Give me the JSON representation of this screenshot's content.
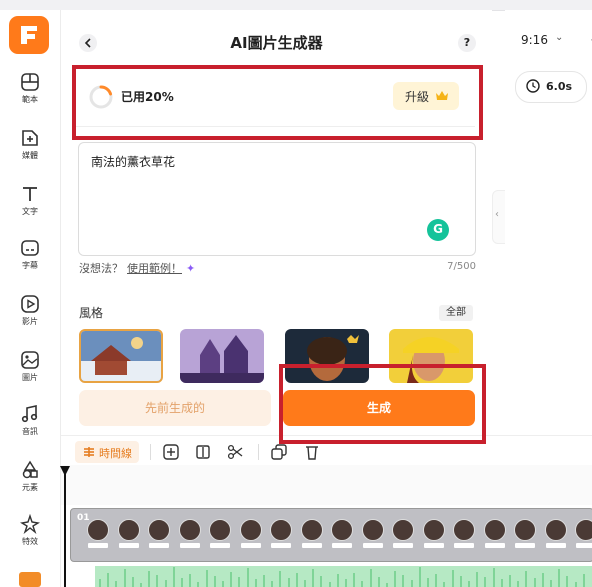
{
  "panel": {
    "title": "AI圖片生成器",
    "help": "?"
  },
  "usage": {
    "text": "已用20%",
    "percent": 0.2,
    "upgrade_label": "升級"
  },
  "prompt": {
    "value": "南法的薰衣草花",
    "char_count": "7/500",
    "grammarly": "G"
  },
  "hint": {
    "text": "沒想法？",
    "link": "使用範例！",
    "sparkle": "✦"
  },
  "style": {
    "label": "風格",
    "all_label": "全部"
  },
  "actions": {
    "previous_label": "先前生成的",
    "generate_label": "生成"
  },
  "sidebar": {
    "items": [
      {
        "label": "範本",
        "icon": "template-icon"
      },
      {
        "label": "媒體",
        "icon": "media-icon"
      },
      {
        "label": "文字",
        "icon": "text-icon"
      },
      {
        "label": "字幕",
        "icon": "subtitle-icon"
      },
      {
        "label": "影片",
        "icon": "video-icon"
      },
      {
        "label": "圖片",
        "icon": "image-icon"
      },
      {
        "label": "音訊",
        "icon": "audio-icon"
      },
      {
        "label": "元素",
        "icon": "elements-icon"
      },
      {
        "label": "特效",
        "icon": "effects-icon"
      }
    ]
  },
  "right": {
    "aspect_ratio": "9:16",
    "duration": "6.0s"
  },
  "timeline": {
    "label": "時間線",
    "clip_number": "01"
  },
  "colors": {
    "accent": "#ff7a1a",
    "highlight_box": "#c8202d",
    "upgrade_bg": "#fff4d6"
  }
}
